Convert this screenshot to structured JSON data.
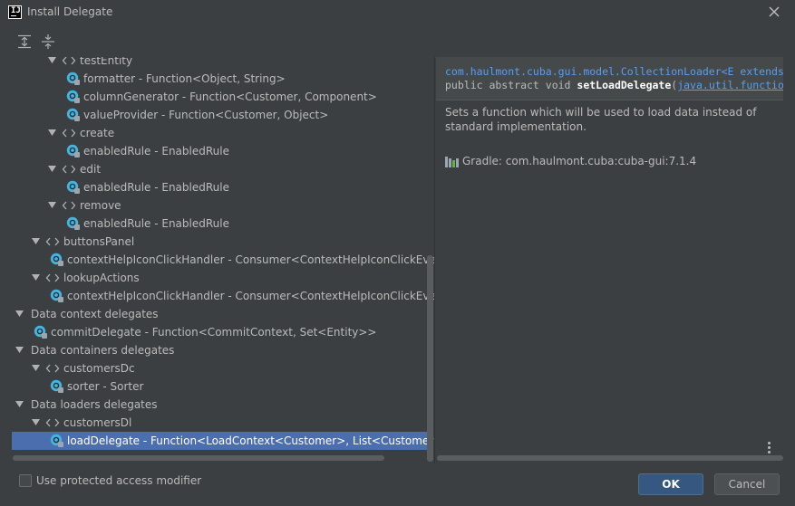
{
  "window": {
    "title": "Install Delegate",
    "app_logo_text": "IJ"
  },
  "toolbar": {
    "expand_all_icon": "expand-all-icon",
    "collapse_all_icon": "collapse-all-icon"
  },
  "tree": {
    "rows": [
      {
        "label": "testEntity",
        "kind": "group",
        "expanded": true
      },
      {
        "label": "formatter - Function<Object, String>",
        "kind": "field"
      },
      {
        "label": "columnGenerator - Function<Customer, Component>",
        "kind": "field"
      },
      {
        "label": "valueProvider - Function<Customer, Object>",
        "kind": "field"
      },
      {
        "label": "create",
        "kind": "group",
        "expanded": true
      },
      {
        "label": "enabledRule - EnabledRule",
        "kind": "field"
      },
      {
        "label": "edit",
        "kind": "group",
        "expanded": true
      },
      {
        "label": "enabledRule - EnabledRule",
        "kind": "field"
      },
      {
        "label": "remove",
        "kind": "group",
        "expanded": true
      },
      {
        "label": "enabledRule - EnabledRule",
        "kind": "field"
      },
      {
        "label": "buttonsPanel",
        "kind": "group",
        "expanded": true
      },
      {
        "label": "contextHelpIconClickHandler - Consumer<ContextHelpIconClickEvent>",
        "kind": "field"
      },
      {
        "label": "lookupActions",
        "kind": "group",
        "expanded": true
      },
      {
        "label": "contextHelpIconClickHandler - Consumer<ContextHelpIconClickEvent>",
        "kind": "field"
      },
      {
        "label": "Data context delegates",
        "kind": "category",
        "expanded": true
      },
      {
        "label": "commitDelegate - Function<CommitContext, Set<Entity>>",
        "kind": "field"
      },
      {
        "label": "Data containers delegates",
        "kind": "category",
        "expanded": true
      },
      {
        "label": "customersDc",
        "kind": "group",
        "expanded": true
      },
      {
        "label": "sorter - Sorter",
        "kind": "field"
      },
      {
        "label": "Data loaders delegates",
        "kind": "category",
        "expanded": true
      },
      {
        "label": "customersDl",
        "kind": "group",
        "expanded": true
      },
      {
        "label": "loadDelegate - Function<LoadContext<Customer>, List<Customer>>",
        "kind": "field",
        "selected": true
      }
    ]
  },
  "doc": {
    "signature_line1": "com.haulmont.cuba.gui.model.CollectionLoader<E extends",
    "signature_line2_prefix": "public abstract void ",
    "signature_method": "setLoadDelegate",
    "signature_line2_paren": "(",
    "signature_param_link": "java.util.function",
    "description": "Sets a function which will be used to load data instead of standard implementation.",
    "library": "Gradle: com.haulmont.cuba:cuba-gui:7.1.4"
  },
  "footer": {
    "checkbox_label": "Use protected access modifier",
    "checkbox_checked": false,
    "ok_label": "OK",
    "cancel_label": "Cancel"
  },
  "colors": {
    "background": "#3c3f41",
    "selection": "#4b6eaf",
    "link": "#589df6",
    "ok_button": "#365880"
  }
}
